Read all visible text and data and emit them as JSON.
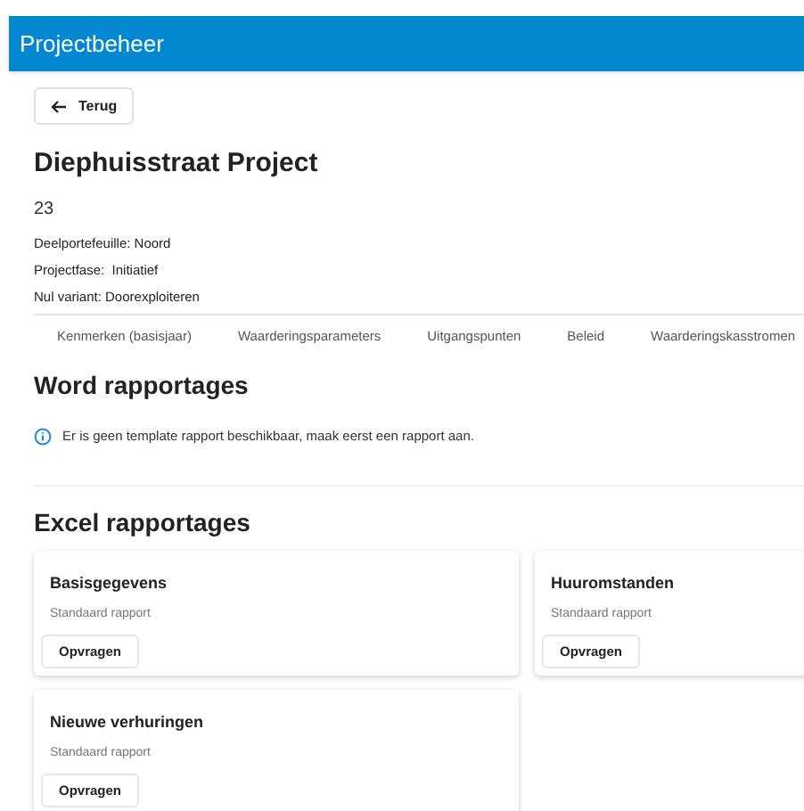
{
  "header": {
    "title": "Projectbeheer"
  },
  "back_button": {
    "label": "Terug"
  },
  "project": {
    "title": "Diephuisstraat Project",
    "number": "23",
    "details": [
      "Deelportefeuille: Noord",
      "Projectfase:  Initiatief",
      "Nul variant: Doorexploiteren"
    ]
  },
  "tabs": [
    {
      "label": "Kenmerken (basisjaar)"
    },
    {
      "label": "Waarderingsparameters"
    },
    {
      "label": "Uitgangspunten"
    },
    {
      "label": "Beleid"
    },
    {
      "label": "Waarderingskasstromen"
    }
  ],
  "word_reports": {
    "title": "Word rapportages",
    "info": "Er is geen template rapport beschikbaar, maak eerst een rapport aan."
  },
  "excel_reports": {
    "title": "Excel rapportages",
    "cards": [
      {
        "title": "Basisgegevens",
        "subtitle": "Standaard rapport",
        "button": "Opvragen"
      },
      {
        "title": "Huuromstanden",
        "subtitle": "Standaard rapport",
        "button": "Opvragen"
      },
      {
        "title": "Nieuwe verhuringen",
        "subtitle": "Standaard rapport",
        "button": "Opvragen"
      }
    ]
  }
}
